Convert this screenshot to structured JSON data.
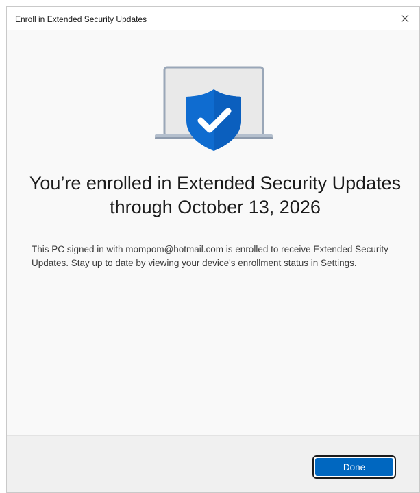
{
  "window": {
    "title": "Enroll in Extended Security Updates",
    "close_icon": "close-icon"
  },
  "hero": {
    "icon": "laptop-shield-check-icon",
    "colors": {
      "shield": "#0f6cd0",
      "laptop_frame": "#9aa7b8",
      "laptop_screen": "#ececec"
    }
  },
  "main": {
    "heading": "You’re enrolled in Extended Security Updates through October 13, 2026",
    "body": "This PC signed in with mompom@hotmail.com is enrolled to receive Extended Security Updates. Stay up to date by viewing your device's enrollment status in Settings."
  },
  "footer": {
    "done_label": "Done",
    "accent_color": "#0067c0"
  }
}
